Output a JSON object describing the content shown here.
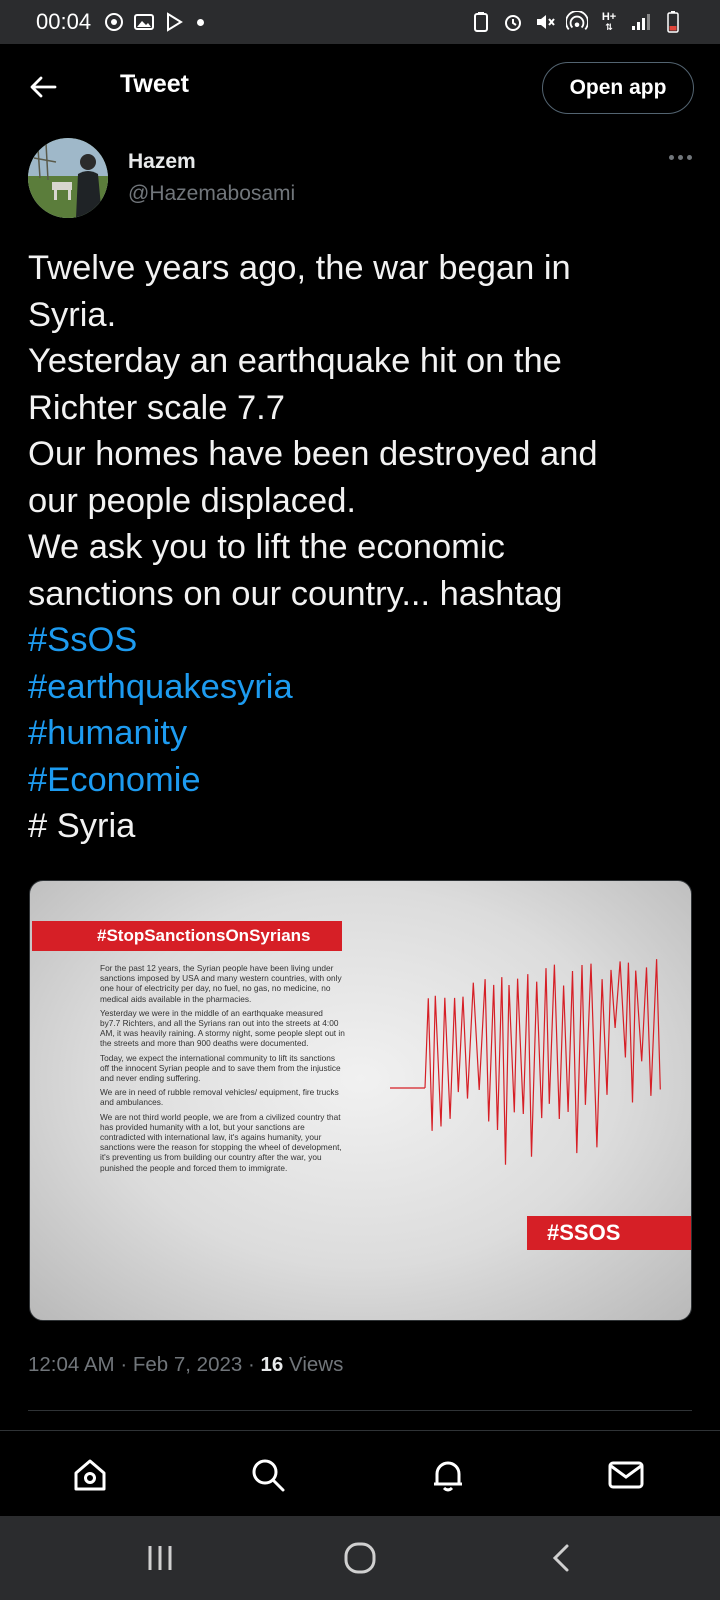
{
  "status_bar": {
    "time": "00:04",
    "network": "H+"
  },
  "header": {
    "title": "Tweet",
    "open_app_label": "Open app"
  },
  "author": {
    "name": "Hazem",
    "handle": "@Hazemabosami"
  },
  "tweet": {
    "lines": [
      {
        "text": "Twelve years ago, the war began in",
        "hashtag": false
      },
      {
        "text": "Syria.",
        "hashtag": false
      },
      {
        "text": "Yesterday an earthquake hit on the",
        "hashtag": false
      },
      {
        "text": "Richter scale 7.7",
        "hashtag": false
      },
      {
        "text": "Our homes have been destroyed and",
        "hashtag": false
      },
      {
        "text": "our people displaced.",
        "hashtag": false
      },
      {
        "text": "We ask you to lift the economic",
        "hashtag": false
      },
      {
        "text": "sanctions on our country... hashtag",
        "hashtag": false
      },
      {
        "text": "#SsOS",
        "hashtag": true
      },
      {
        "text": "#earthquakesyria",
        "hashtag": true
      },
      {
        "text": "#humanity",
        "hashtag": true
      },
      {
        "text": "#Economie",
        "hashtag": true
      },
      {
        "text": "# Syria",
        "hashtag": false
      }
    ]
  },
  "media": {
    "banner": "#StopSanctionsOnSyrians",
    "paragraphs": [
      "For the past 12 years, the Syrian people have been living under sanctions imposed by USA and many western countries, with only one hour of electricity per day, no fuel, no gas, no medicine, no medical aids available in the pharmacies.",
      "Yesterday we were in the middle of an earthquake measured by7.7 Richters, and all the Syrians ran out into the streets at 4:00 AM, it was heavily raining. A stormy night, some people slept out in the streets and more than 900 deaths were documented.",
      "Today, we expect the international community to lift its sanctions off the innocent Syrian people and to save them from the injustice and never ending suffering.",
      "We are in need of rubble removal vehicles/ equipment, fire trucks and ambulances.",
      "We are not third world people, we are from a civilized country that has provided humanity with a lot, but your sanctions are contradicted with international law, it's agains humanity, your sanctions were the reason for stopping the wheel of development, it's preventing us from building our country after the war, you punished the people and forced them to immigrate."
    ],
    "badge": "#SSOS",
    "accent_color": "#d61f26"
  },
  "meta": {
    "time": "12:04 AM",
    "separator": "·",
    "date": "Feb 7, 2023",
    "views_count": "16",
    "views_label": "Views"
  },
  "bottom_nav": [
    "home-icon",
    "search-icon",
    "notifications-icon",
    "messages-icon"
  ],
  "system_nav": [
    "recents-icon",
    "home-icon",
    "back-icon"
  ],
  "colors": {
    "hashtag": "#1d9bf0",
    "secondary_text": "#71767b",
    "status_bar": "#2b2c2e"
  }
}
